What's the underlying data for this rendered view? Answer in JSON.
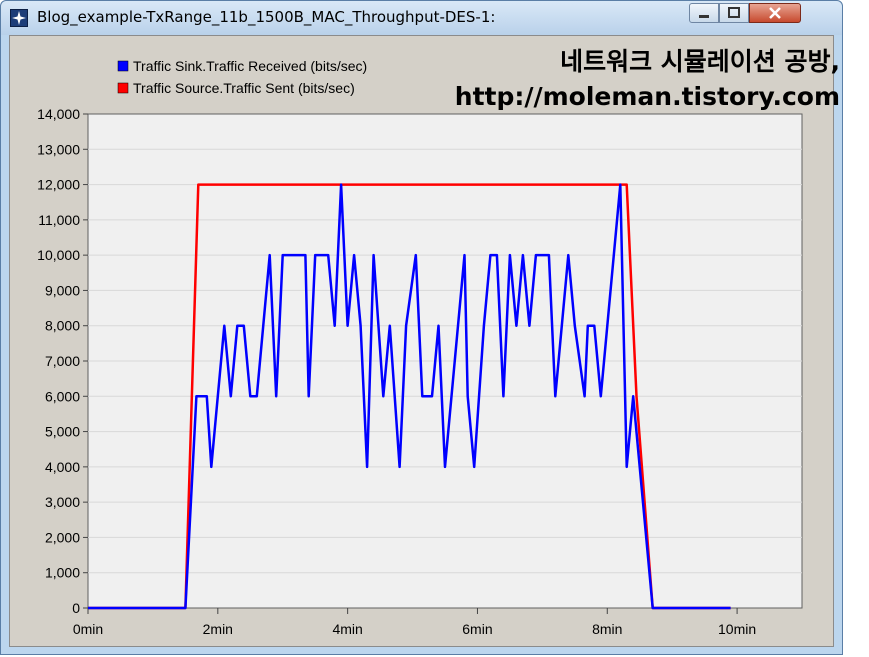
{
  "window": {
    "title": "Blog_example-TxRange_11b_1500B_MAC_Throughput-DES-1:",
    "buttons": {
      "minimize": "−",
      "maximize": "□",
      "close": "✕"
    }
  },
  "overlay": {
    "line1": "네트워크 시뮬레이션 공방,",
    "line2": "http://moleman.tistory.com"
  },
  "chart_data": {
    "type": "line",
    "x_unit": "min",
    "xlim": [
      0,
      11
    ],
    "ylim": [
      0,
      14000
    ],
    "x_ticks": [
      0,
      2,
      4,
      6,
      8,
      10
    ],
    "x_tick_labels": [
      "0min",
      "2min",
      "4min",
      "6min",
      "8min",
      "10min"
    ],
    "y_ticks": [
      0,
      1000,
      2000,
      3000,
      4000,
      5000,
      6000,
      7000,
      8000,
      9000,
      10000,
      11000,
      12000,
      13000,
      14000
    ],
    "y_tick_labels": [
      "0",
      "1,000",
      "2,000",
      "3,000",
      "4,000",
      "5,000",
      "6,000",
      "7,000",
      "8,000",
      "9,000",
      "10,000",
      "11,000",
      "12,000",
      "13,000",
      "14,000"
    ],
    "grid": true,
    "legend_position": "top-left",
    "series": [
      {
        "name": "Traffic Sink.Traffic Received (bits/sec)",
        "color": "#0000ff",
        "points": [
          [
            0,
            0
          ],
          [
            1.5,
            0
          ],
          [
            1.67,
            6000
          ],
          [
            1.75,
            6000
          ],
          [
            1.83,
            6000
          ],
          [
            1.9,
            4000
          ],
          [
            2.0,
            6000
          ],
          [
            2.1,
            8000
          ],
          [
            2.2,
            6000
          ],
          [
            2.3,
            8000
          ],
          [
            2.4,
            8000
          ],
          [
            2.5,
            6000
          ],
          [
            2.6,
            6000
          ],
          [
            2.8,
            10000
          ],
          [
            2.9,
            6000
          ],
          [
            3.0,
            10000
          ],
          [
            3.1,
            10000
          ],
          [
            3.2,
            10000
          ],
          [
            3.35,
            10000
          ],
          [
            3.4,
            6000
          ],
          [
            3.5,
            10000
          ],
          [
            3.6,
            10000
          ],
          [
            3.7,
            10000
          ],
          [
            3.8,
            8000
          ],
          [
            3.9,
            12000
          ],
          [
            4.0,
            8000
          ],
          [
            4.1,
            10000
          ],
          [
            4.2,
            8000
          ],
          [
            4.3,
            4000
          ],
          [
            4.4,
            10000
          ],
          [
            4.55,
            6000
          ],
          [
            4.65,
            8000
          ],
          [
            4.8,
            4000
          ],
          [
            4.9,
            8000
          ],
          [
            5.05,
            10000
          ],
          [
            5.15,
            6000
          ],
          [
            5.3,
            6000
          ],
          [
            5.4,
            8000
          ],
          [
            5.5,
            4000
          ],
          [
            5.6,
            6000
          ],
          [
            5.8,
            10000
          ],
          [
            5.85,
            6000
          ],
          [
            5.95,
            4000
          ],
          [
            6.1,
            8000
          ],
          [
            6.2,
            10000
          ],
          [
            6.3,
            10000
          ],
          [
            6.4,
            6000
          ],
          [
            6.5,
            10000
          ],
          [
            6.6,
            8000
          ],
          [
            6.7,
            10000
          ],
          [
            6.8,
            8000
          ],
          [
            6.9,
            10000
          ],
          [
            7.0,
            10000
          ],
          [
            7.1,
            10000
          ],
          [
            7.2,
            6000
          ],
          [
            7.3,
            8000
          ],
          [
            7.4,
            10000
          ],
          [
            7.5,
            8000
          ],
          [
            7.65,
            6000
          ],
          [
            7.7,
            8000
          ],
          [
            7.8,
            8000
          ],
          [
            7.9,
            6000
          ],
          [
            8.0,
            8000
          ],
          [
            8.2,
            12000
          ],
          [
            8.3,
            4000
          ],
          [
            8.4,
            6000
          ],
          [
            8.5,
            4000
          ],
          [
            8.7,
            0
          ],
          [
            9.9,
            0
          ]
        ]
      },
      {
        "name": "Traffic Source.Traffic Sent (bits/sec)",
        "color": "#ff0000",
        "points": [
          [
            0,
            0
          ],
          [
            1.5,
            0
          ],
          [
            1.7,
            12000
          ],
          [
            8.2,
            12000
          ],
          [
            8.3,
            12000
          ],
          [
            8.45,
            6000
          ],
          [
            8.7,
            0
          ],
          [
            9.9,
            0
          ]
        ]
      }
    ]
  }
}
